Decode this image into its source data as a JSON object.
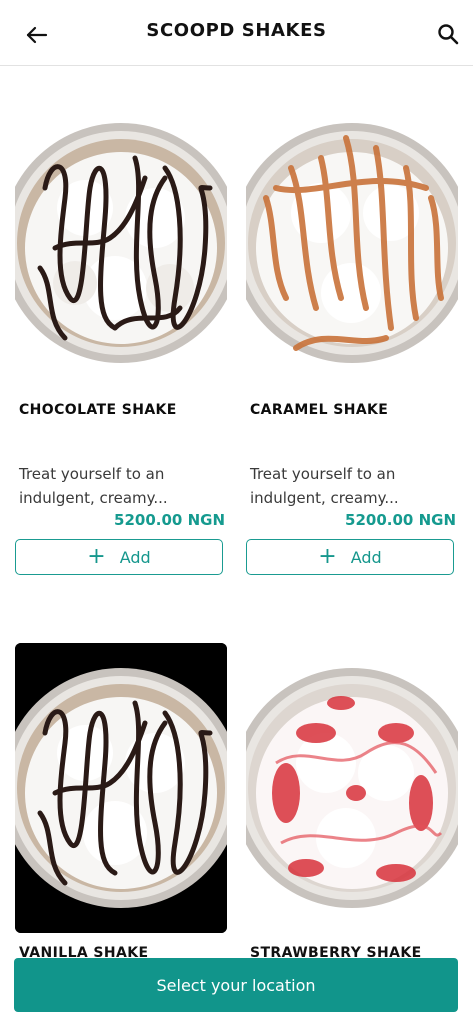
{
  "header": {
    "title": "SCOOPD SHAKES",
    "back_icon": "arrow-left-icon",
    "search_icon": "search-icon"
  },
  "products": [
    {
      "name": "CHOCOLATE SHAKE",
      "description_line1": "Treat yourself to an",
      "description_line2": "indulgent, creamy...",
      "price": "5200.00 NGN",
      "add_label": "Add",
      "image": "chocolate-shake-image"
    },
    {
      "name": "CARAMEL SHAKE",
      "description_line1": "Treat yourself to an",
      "description_line2": "indulgent, creamy...",
      "price": "5200.00 NGN",
      "add_label": "Add",
      "image": "caramel-shake-image"
    },
    {
      "name": "VANILLA SHAKE",
      "image": "vanilla-shake-image"
    },
    {
      "name": "STRAWBERRY SHAKE",
      "image": "strawberry-shake-image"
    }
  ],
  "footer": {
    "location_button": "Select your location"
  },
  "colors": {
    "accent": "#11958b",
    "price": "#159a8f",
    "chocolate_drizzle": "#2a1a16",
    "caramel_drizzle": "#c9733a",
    "strawberry_drizzle": "#d8323c"
  }
}
